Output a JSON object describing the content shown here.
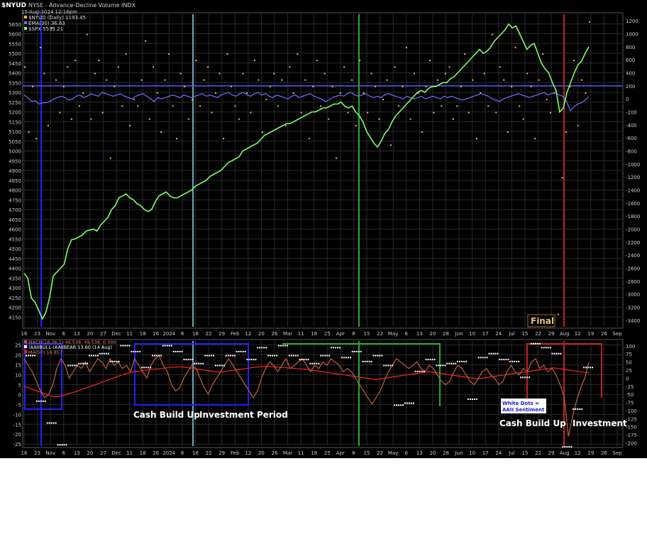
{
  "header": {
    "symbol": "$NYUD",
    "subtitle": "NYSE - Advance-Decline Volume INDX",
    "timestamp": "15-Aug-2024 12:16pm",
    "legend": [
      {
        "label": "$NYUD (Daily) 1193.45",
        "color": "#ffb347"
      },
      {
        "label": "EMA(30) 36.63",
        "color": "#6f6fff"
      },
      {
        "label": "$SPX 5533.21",
        "color": "#7fff5f"
      }
    ]
  },
  "colors": {
    "spx": "#7fff5f",
    "nyud_dots": "#ffb347",
    "ema": "#6f6fff",
    "macd": "#c0603a",
    "macd_signal": "#ff2020",
    "vline_blue": "#2020ff",
    "vline_cyan": "#6fa7b7",
    "vline_green": "#28a828",
    "vline_red": "#c02020",
    "vline_orange": "#c87a28",
    "grid": "#2a2a2a"
  },
  "chart_data": [
    {
      "type": "line",
      "title": "$NYUD",
      "left_axis": {
        "label": "$SPX",
        "range": [
          4100,
          5700
        ],
        "ticks": [
          4150,
          4200,
          4250,
          4300,
          4350,
          4400,
          4450,
          4500,
          4550,
          4600,
          4650,
          4700,
          4750,
          4800,
          4850,
          4900,
          4950,
          5000,
          5050,
          5100,
          5150,
          5200,
          5250,
          5300,
          5350,
          5400,
          5450,
          5500,
          5550,
          5600,
          5650
        ]
      },
      "right_axis": {
        "range": [
          -3500,
          1300
        ],
        "ticks": [
          1200,
          1000,
          800,
          600,
          400,
          200,
          0,
          -200,
          -400,
          -600,
          -800,
          -1000,
          -1200,
          -1400,
          -1600,
          -1800,
          -2000,
          -2200,
          -2400,
          -2600,
          -2800,
          -3000,
          -3200,
          -3400
        ]
      },
      "x_ticks": [
        "16",
        "23",
        "Nov",
        "6",
        "13",
        "20",
        "27",
        "Dec",
        "11",
        "18",
        "26",
        "2024",
        "8",
        "16",
        "22",
        "29",
        "Feb",
        "12",
        "20",
        "26",
        "Mar",
        "11",
        "18",
        "25",
        "Apr",
        "8",
        "15",
        "22",
        "May",
        "6",
        "13",
        "20",
        "28",
        "Jun",
        "10",
        "17",
        "24",
        "Jul",
        "15",
        "22",
        "29",
        "Aug",
        "12",
        "19",
        "26",
        "Sep"
      ],
      "series": [
        {
          "name": "$SPX 5533.21",
          "axis": "left",
          "values": [
            4373,
            4350,
            4247,
            4225,
            4185,
            4140,
            4175,
            4250,
            4360,
            4380,
            4400,
            4420,
            4500,
            4545,
            4550,
            4560,
            4570,
            4590,
            4595,
            4600,
            4590,
            4620,
            4640,
            4660,
            4700,
            4720,
            4760,
            4770,
            4780,
            4760,
            4750,
            4730,
            4720,
            4700,
            4690,
            4700,
            4740,
            4770,
            4780,
            4790,
            4770,
            4760,
            4760,
            4770,
            4780,
            4790,
            4800,
            4820,
            4830,
            4840,
            4850,
            4870,
            4880,
            4890,
            4900,
            4920,
            4940,
            4950,
            4960,
            4970,
            5000,
            5010,
            5020,
            5030,
            5040,
            5060,
            5080,
            5090,
            5100,
            5110,
            5120,
            5130,
            5140,
            5140,
            5150,
            5160,
            5170,
            5180,
            5190,
            5200,
            5200,
            5210,
            5220,
            5220,
            5230,
            5240,
            5240,
            5250,
            5230,
            5220,
            5230,
            5200,
            5180,
            5150,
            5100,
            5070,
            5040,
            5020,
            5050,
            5090,
            5110,
            5150,
            5180,
            5200,
            5220,
            5240,
            5260,
            5280,
            5300,
            5310,
            5300,
            5320,
            5330,
            5330,
            5340,
            5350,
            5350,
            5370,
            5380,
            5400,
            5420,
            5440,
            5460,
            5480,
            5500,
            5520,
            5500,
            5510,
            5530,
            5560,
            5580,
            5600,
            5620,
            5650,
            5630,
            5640,
            5600,
            5560,
            5520,
            5540,
            5550,
            5500,
            5450,
            5420,
            5400,
            5350,
            5310,
            5200,
            5220,
            5300,
            5350,
            5400,
            5440,
            5460,
            5500,
            5533
          ]
        },
        {
          "name": "EMA(30) 36.63",
          "axis": "right",
          "values": [
            60,
            20,
            -40,
            -30,
            -80,
            -60,
            -60,
            -40,
            0,
            20,
            40,
            20,
            -20,
            0,
            40,
            60,
            20,
            40,
            80,
            60,
            40,
            100,
            80,
            60,
            40,
            60,
            80,
            40,
            20,
            0,
            40,
            60,
            80,
            40,
            0,
            -40,
            20,
            0,
            20,
            40,
            60,
            40,
            20,
            60,
            40,
            20,
            40,
            60,
            80,
            40,
            60,
            40,
            20,
            60,
            80,
            100,
            60,
            40,
            80,
            100,
            60,
            40,
            80,
            100,
            60,
            80,
            40,
            20,
            60,
            40,
            20,
            0,
            40,
            60,
            20,
            40,
            60,
            80,
            40,
            20,
            0,
            -40,
            -20,
            20,
            40,
            60,
            40,
            80,
            100,
            60,
            40,
            60,
            80,
            40,
            20,
            40,
            20,
            60,
            80,
            60,
            40,
            20,
            0,
            40,
            20,
            0,
            20,
            40,
            0,
            20,
            40,
            20,
            0,
            40,
            20,
            40,
            20,
            0,
            -20,
            0,
            20,
            40,
            60,
            80,
            60,
            40,
            0,
            -20,
            -40,
            0,
            20,
            40,
            60,
            80,
            60,
            40,
            20,
            40,
            60,
            80,
            100,
            60,
            80,
            100,
            60,
            40,
            -40,
            -180,
            -120,
            -80,
            -60,
            -20,
            36
          ]
        },
        {
          "name": "$NYUD (Daily) 1193.45",
          "axis": "right",
          "style": "dots",
          "values": [
            500,
            -500,
            200,
            -600,
            800,
            400,
            -400,
            1100,
            300,
            -200,
            200,
            500,
            -300,
            600,
            -100,
            100,
            1000,
            -300,
            400,
            600,
            -200,
            300,
            -900,
            200,
            500,
            -100,
            700,
            -400,
            0,
            -100,
            300,
            900,
            -300,
            500,
            100,
            -500,
            300,
            700,
            -100,
            -600,
            400,
            200,
            -300,
            0,
            600,
            -100,
            300,
            500,
            -200,
            100,
            400,
            -600,
            700,
            200,
            -100,
            -300,
            400,
            100,
            -200,
            600,
            300,
            -500,
            0,
            200,
            400,
            -100,
            300,
            -400,
            500,
            100,
            700,
            -200,
            300,
            -600,
            200,
            600,
            -100,
            400,
            -300,
            200,
            -900,
            100,
            500,
            -200,
            300,
            -400,
            600,
            100,
            -200,
            400,
            200,
            -300,
            0,
            300,
            -700,
            500,
            -100,
            200,
            800,
            -300,
            400,
            100,
            -500,
            200,
            600,
            -200,
            300,
            -100,
            400,
            500,
            -300,
            -100,
            200,
            700,
            -200,
            300,
            -600,
            100,
            400,
            -100,
            1000,
            -200,
            500,
            300,
            -500,
            200,
            800,
            -100,
            -300,
            400,
            200,
            -600,
            300,
            700,
            0,
            -200,
            100,
            -3300,
            -1200,
            -500,
            200,
            600,
            -400,
            300,
            100,
            1193
          ]
        }
      ]
    },
    {
      "type": "line",
      "title": "MACD(18,36,1)",
      "left_axis": {
        "range": [
          -26,
          27
        ],
        "ticks": [
          25,
          20,
          15,
          10,
          5,
          0,
          -5,
          -10,
          -15,
          -20,
          -25
        ]
      },
      "right_axis": {
        "range": [
          -210,
          115
        ],
        "ticks": [
          100,
          75,
          50,
          25,
          0,
          -25,
          -50,
          -75,
          -100,
          -125,
          -150,
          -175,
          -200
        ]
      },
      "legend": [
        {
          "label": "MACD(18,36,1) 49.538, 49.538, 0.000"
        },
        {
          "label": "!AAIIBULL-!AAIIBEAR 13.60 (14 Aug)"
        },
        {
          "label": "MA(50) 16.857"
        }
      ],
      "series": [
        {
          "name": "MACD(18,36,1) 49.538",
          "axis": "right",
          "values": [
            60,
            40,
            20,
            -10,
            -40,
            -60,
            -50,
            -20,
            30,
            60,
            40,
            0,
            20,
            40,
            30,
            50,
            20,
            40,
            60,
            50,
            30,
            60,
            40,
            50,
            30,
            40,
            20,
            60,
            40,
            20,
            0,
            40,
            60,
            70,
            40,
            20,
            -20,
            -40,
            -30,
            0,
            20,
            40,
            30,
            0,
            -30,
            -50,
            -20,
            0,
            20,
            40,
            60,
            40,
            20,
            0,
            -20,
            -40,
            -60,
            -40,
            0,
            30,
            50,
            40,
            20,
            40,
            60,
            30,
            40,
            50,
            60,
            40,
            20,
            40,
            30,
            50,
            40,
            60,
            50,
            40,
            20,
            30,
            20,
            0,
            -20,
            -40,
            -60,
            -80,
            -60,
            -40,
            -10,
            20,
            40,
            60,
            50,
            40,
            30,
            40,
            50,
            30,
            20,
            40,
            30,
            10,
            -10,
            -20,
            -10,
            20,
            40,
            30,
            10,
            -10,
            -20,
            0,
            20,
            30,
            10,
            0,
            -20,
            -10,
            20,
            40,
            20,
            10,
            30,
            20,
            50,
            60,
            30,
            40,
            20,
            30,
            10,
            -20,
            -60,
            -180,
            -120,
            -70,
            -30,
            0,
            49
          ]
        },
        {
          "name": "MA(50) 16.857",
          "axis": "right",
          "values": [
            -25,
            -30,
            -35,
            -40,
            -45,
            -50,
            -55,
            -58,
            -56,
            -52,
            -48,
            -44,
            -40,
            -35,
            -30,
            -25,
            -20,
            -15,
            -10,
            -5,
            0,
            5,
            10,
            14,
            18,
            20,
            22,
            24,
            26,
            28,
            28,
            30,
            32,
            34,
            34,
            35,
            34,
            32,
            30,
            28,
            26,
            24,
            22,
            20,
            18,
            20,
            22,
            24,
            26,
            28,
            30,
            32,
            34,
            35,
            36,
            36,
            35,
            34,
            33,
            32,
            31,
            30,
            29,
            28,
            26,
            24,
            22,
            20,
            18,
            16,
            14,
            12,
            10,
            8,
            6,
            4,
            2,
            0,
            -2,
            -4,
            -2,
            0,
            2,
            4,
            6,
            8,
            10,
            12,
            14,
            16,
            18,
            20,
            18,
            16,
            14,
            12,
            10,
            8,
            6,
            4,
            2,
            0,
            -2,
            0,
            2,
            4,
            6,
            8,
            10,
            12,
            14,
            16,
            18,
            20,
            22,
            24,
            26,
            28,
            30,
            32,
            30,
            28,
            26,
            24,
            22,
            20,
            18,
            17
          ]
        },
        {
          "name": "!AAIIBULL-!AAIIBEAR 13.60 (14 Aug)",
          "axis": "left",
          "style": "dots",
          "values": [
            20,
            -3,
            -14,
            -25,
            15,
            16,
            20,
            21,
            17,
            25,
            22,
            14,
            20,
            25,
            22,
            18,
            16,
            20,
            15,
            20,
            22,
            18,
            24,
            20,
            25,
            20,
            18,
            16,
            20,
            24,
            19,
            22,
            17,
            20,
            15,
            -5,
            -4,
            12,
            18,
            15,
            16,
            17,
            -2,
            19,
            21,
            18,
            17,
            9,
            26,
            24,
            21,
            -26,
            -7,
            14
          ]
        }
      ]
    }
  ],
  "annotations": {
    "final": "Final",
    "cash1": "Cash Build Up",
    "invest1": "Investment Period",
    "cash2": "Cash Build Up",
    "invest2": "Investment",
    "white_dots": "White Dots =\nAAII Sentiment"
  }
}
